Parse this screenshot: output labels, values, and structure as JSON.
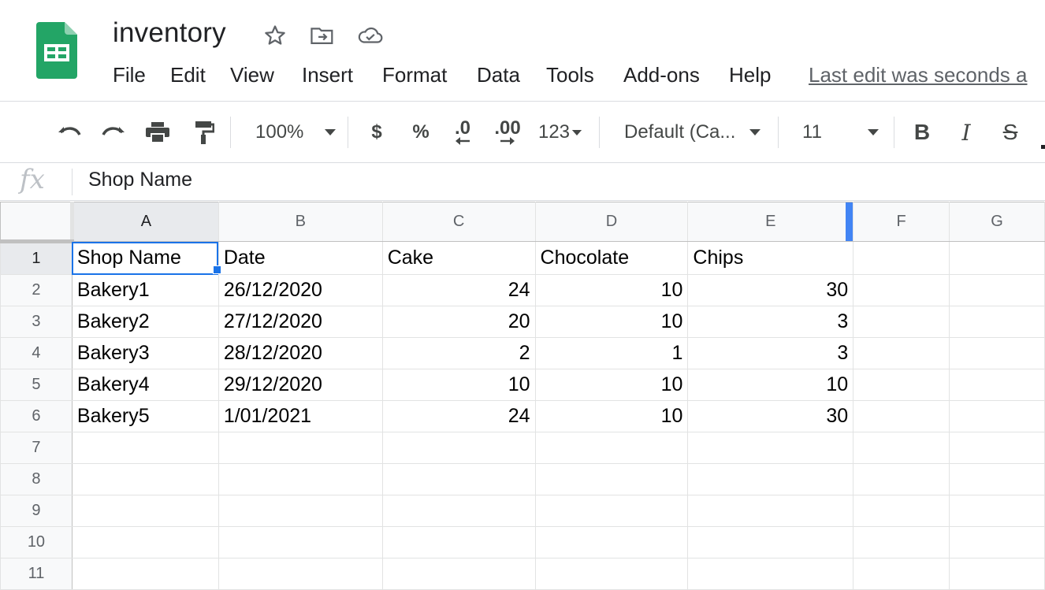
{
  "app": {
    "title": "inventory",
    "logo_icon": "google-sheets-logo-icon",
    "header_icons": [
      "star-icon",
      "move-to-folder-icon",
      "cloud-saved-icon"
    ],
    "colors": {
      "brand_green": "#23a566",
      "selection_blue": "#1a73e8"
    }
  },
  "menu": {
    "items": [
      "File",
      "Edit",
      "View",
      "Insert",
      "Format",
      "Data",
      "Tools",
      "Add-ons",
      "Help"
    ],
    "last_edit": "Last edit was seconds a"
  },
  "toolbar": {
    "zoom": "100%",
    "currency": "$",
    "percent": "%",
    "decrease_decimal": ".0",
    "increase_decimal": ".00",
    "more_formats": "123",
    "font": "Default (Ca...",
    "font_size": "11",
    "bold": "B",
    "italic": "I",
    "strikethrough": "S"
  },
  "formula_bar": {
    "fx": "fx",
    "value": "Shop Name"
  },
  "sheet": {
    "columns": [
      "A",
      "B",
      "C",
      "D",
      "E",
      "F",
      "G"
    ],
    "row_numbers": [
      "1",
      "2",
      "3",
      "4",
      "5",
      "6",
      "7",
      "8",
      "9",
      "10",
      "11"
    ],
    "rows": [
      [
        "Shop Name",
        "Date",
        "Cake",
        "Chocolate",
        "Chips",
        "",
        ""
      ],
      [
        "Bakery1",
        "26/12/2020",
        "24",
        "10",
        "30",
        "",
        ""
      ],
      [
        "Bakery2",
        "27/12/2020",
        "20",
        "10",
        "3",
        "",
        ""
      ],
      [
        "Bakery3",
        "28/12/2020",
        "2",
        "1",
        "3",
        "",
        ""
      ],
      [
        "Bakery4",
        "29/12/2020",
        "10",
        "10",
        "10",
        "",
        ""
      ],
      [
        "Bakery5",
        "1/01/2021",
        "24",
        "10",
        "30",
        "",
        ""
      ],
      [
        "",
        "",
        "",
        "",
        "",
        "",
        ""
      ],
      [
        "",
        "",
        "",
        "",
        "",
        "",
        ""
      ],
      [
        "",
        "",
        "",
        "",
        "",
        "",
        ""
      ],
      [
        "",
        "",
        "",
        "",
        "",
        "",
        ""
      ],
      [
        "",
        "",
        "",
        "",
        "",
        "",
        ""
      ]
    ],
    "active_cell": "A1"
  }
}
